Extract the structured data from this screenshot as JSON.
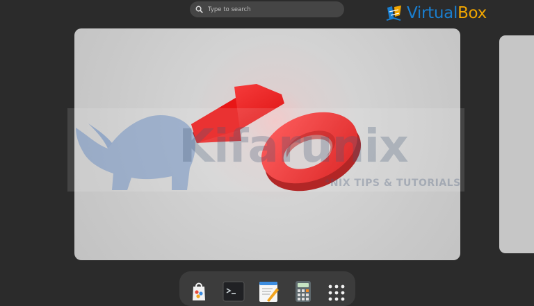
{
  "search": {
    "placeholder": "Type to search"
  },
  "branding": {
    "logo_part1": "Virtual",
    "logo_part2": "Box"
  },
  "watermark": {
    "title": "Kifarunix",
    "subtitle": "*NIX TIPS & TUTORIALS"
  },
  "wallpaper": {
    "graphic": "number-10-3d",
    "text": "10"
  },
  "dock": {
    "apps": [
      {
        "name": "Software",
        "icon": "software-bag-icon"
      },
      {
        "name": "Terminal",
        "icon": "terminal-icon"
      },
      {
        "name": "Text Editor",
        "icon": "text-editor-icon"
      },
      {
        "name": "Calculator",
        "icon": "calculator-icon"
      },
      {
        "name": "Show Apps",
        "icon": "app-grid-icon"
      }
    ]
  },
  "colors": {
    "background": "#2b2b2b",
    "accent_red": "#e01010",
    "virtualbox_blue": "#1a7fd0",
    "virtualbox_orange": "#f0a500"
  }
}
